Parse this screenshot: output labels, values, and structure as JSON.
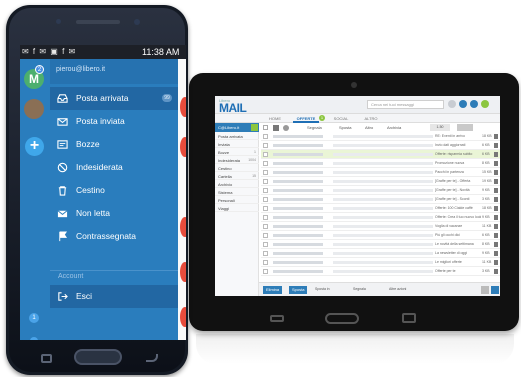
{
  "phone": {
    "status": {
      "icons": "✉ f ✉ ▣ f ✉",
      "time": "11:38 AM"
    },
    "rail": {
      "avatar_letter": "M",
      "avatar_badge": "2",
      "add_label": "+",
      "bottom_badge": "1"
    },
    "account_email": "pierou@libero.it",
    "folders": [
      {
        "label": "Posta arrivata",
        "icon": "inbox-icon",
        "count": "99"
      },
      {
        "label": "Posta inviata",
        "icon": "send-icon",
        "count": ""
      },
      {
        "label": "Bozze",
        "icon": "drafts-icon",
        "count": ""
      },
      {
        "label": "Indesiderata",
        "icon": "spam-icon",
        "count": ""
      },
      {
        "label": "Cestino",
        "icon": "trash-icon",
        "count": ""
      },
      {
        "label": "Non letta",
        "icon": "unread-icon",
        "count": ""
      },
      {
        "label": "Contrassegnata",
        "icon": "flag-icon",
        "count": ""
      }
    ],
    "section_label": "Account",
    "logout_label": "Esci",
    "colors": {
      "drawer": "#2a7dbd",
      "selected": "#2267a3",
      "accent": "#3fa7ea"
    }
  },
  "tablet": {
    "logo_small": "Libero",
    "logo": "MAIL",
    "search_placeholder": "Cerca nei tuoi messaggi",
    "tabs": [
      {
        "label": "HOME",
        "active": false
      },
      {
        "label": "OFFERTE",
        "active": true
      },
      {
        "label": "SOCIAL",
        "active": false
      },
      {
        "label": "ALTRO",
        "active": false
      }
    ],
    "tab_count": "1",
    "account_label": "C@Libero.it",
    "sidebar": [
      {
        "label": "Posta arrivata",
        "count": ""
      },
      {
        "label": "Inviata",
        "count": ""
      },
      {
        "label": "Bozze",
        "count": "1"
      },
      {
        "label": "Indesiderata",
        "count": "1004"
      },
      {
        "label": "Cestino",
        "count": ""
      },
      {
        "label": "Cartella",
        "count": "15"
      },
      {
        "label": "Archivio",
        "count": ""
      },
      {
        "label": "Sistema",
        "count": ""
      },
      {
        "label": "Personali",
        "count": ""
      },
      {
        "label": "Viaggi",
        "count": ""
      }
    ],
    "toolbar": [
      "Segnala",
      "Sposta",
      "Altro",
      "Archivia"
    ],
    "page_label": "1-50",
    "messages": [
      {
        "subject": "RE: Eventi in arrivo",
        "size": "18 KB"
      },
      {
        "subject": "Invio dati aggiornati",
        "size": "6 KB"
      },
      {
        "subject": "Offerte: risparmia subito",
        "size": "6 KB"
      },
      {
        "subject": "Promozione nuova",
        "size": "8 KB"
      },
      {
        "subject": "Pacchi in partenza",
        "size": "15 KB"
      },
      {
        "subject": "[Graffe per te] - Offerta",
        "size": "19 KB"
      },
      {
        "subject": "[Graffe per te] - Novità",
        "size": "9 KB"
      },
      {
        "subject": "[Graffe per te] - Sconti",
        "size": "3 KB"
      },
      {
        "subject": "Offerte: 100 Cialde caffè",
        "size": "18 KB"
      },
      {
        "subject": "Offerte: Crea il tuo nuovo look",
        "size": "9 KB"
      },
      {
        "subject": "Voglia di vacanze",
        "size": "11 KB"
      },
      {
        "subject": "Più gli occhi dici",
        "size": "6 KB"
      },
      {
        "subject": "Le novità della settimana",
        "size": "8 KB"
      },
      {
        "subject": "La newsletter di oggi",
        "size": "9 KB"
      },
      {
        "subject": "Le migliori offerte",
        "size": "11 KB"
      },
      {
        "subject": "Offerte per te",
        "size": "3 KB"
      }
    ],
    "bottom": {
      "btn1": "Elimina",
      "btn2": "Sposta",
      "sel1": "Sposta in",
      "sel2": "Segnala",
      "sel3": "Altre azioni"
    },
    "colors": {
      "brand": "#1f6fb5",
      "green": "#8cc63f"
    }
  }
}
